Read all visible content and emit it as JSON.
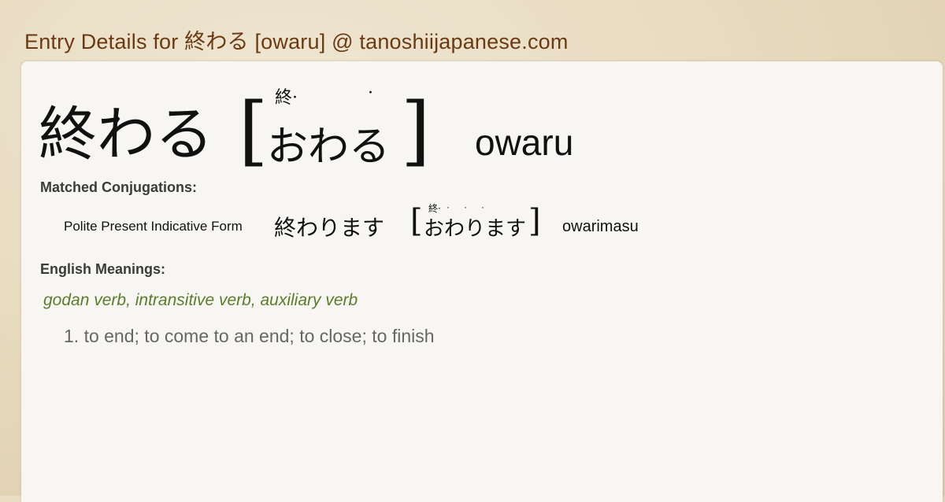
{
  "page": {
    "title": "Entry Details for 終わる [owaru] @ tanoshiijapanese.com"
  },
  "entry": {
    "kanji": "終わる",
    "bracket_open": "[",
    "bracket_close": "]",
    "furigana": "終·",
    "furigana_dot": "·",
    "kana": "おわる",
    "romaji": "owaru"
  },
  "sections": {
    "matched_conjugations_label": "Matched Conjugations:",
    "english_meanings_label": "English Meanings:"
  },
  "conjugations": [
    {
      "form_name": "Polite Present Indicative Form",
      "kanji": "終わります",
      "furigana": "終·",
      "furigana_dots": "···",
      "kana": "おわります",
      "romaji": "owarimasu"
    }
  ],
  "meanings": {
    "parts_of_speech": "godan verb, intransitive verb, auxiliary verb",
    "items": [
      "1. to end; to come to an end; to close; to finish"
    ]
  },
  "colors": {
    "title": "#6b3a12",
    "pos": "#5a7d2a",
    "meaning": "#666666",
    "panel": "#f7f6f3"
  }
}
